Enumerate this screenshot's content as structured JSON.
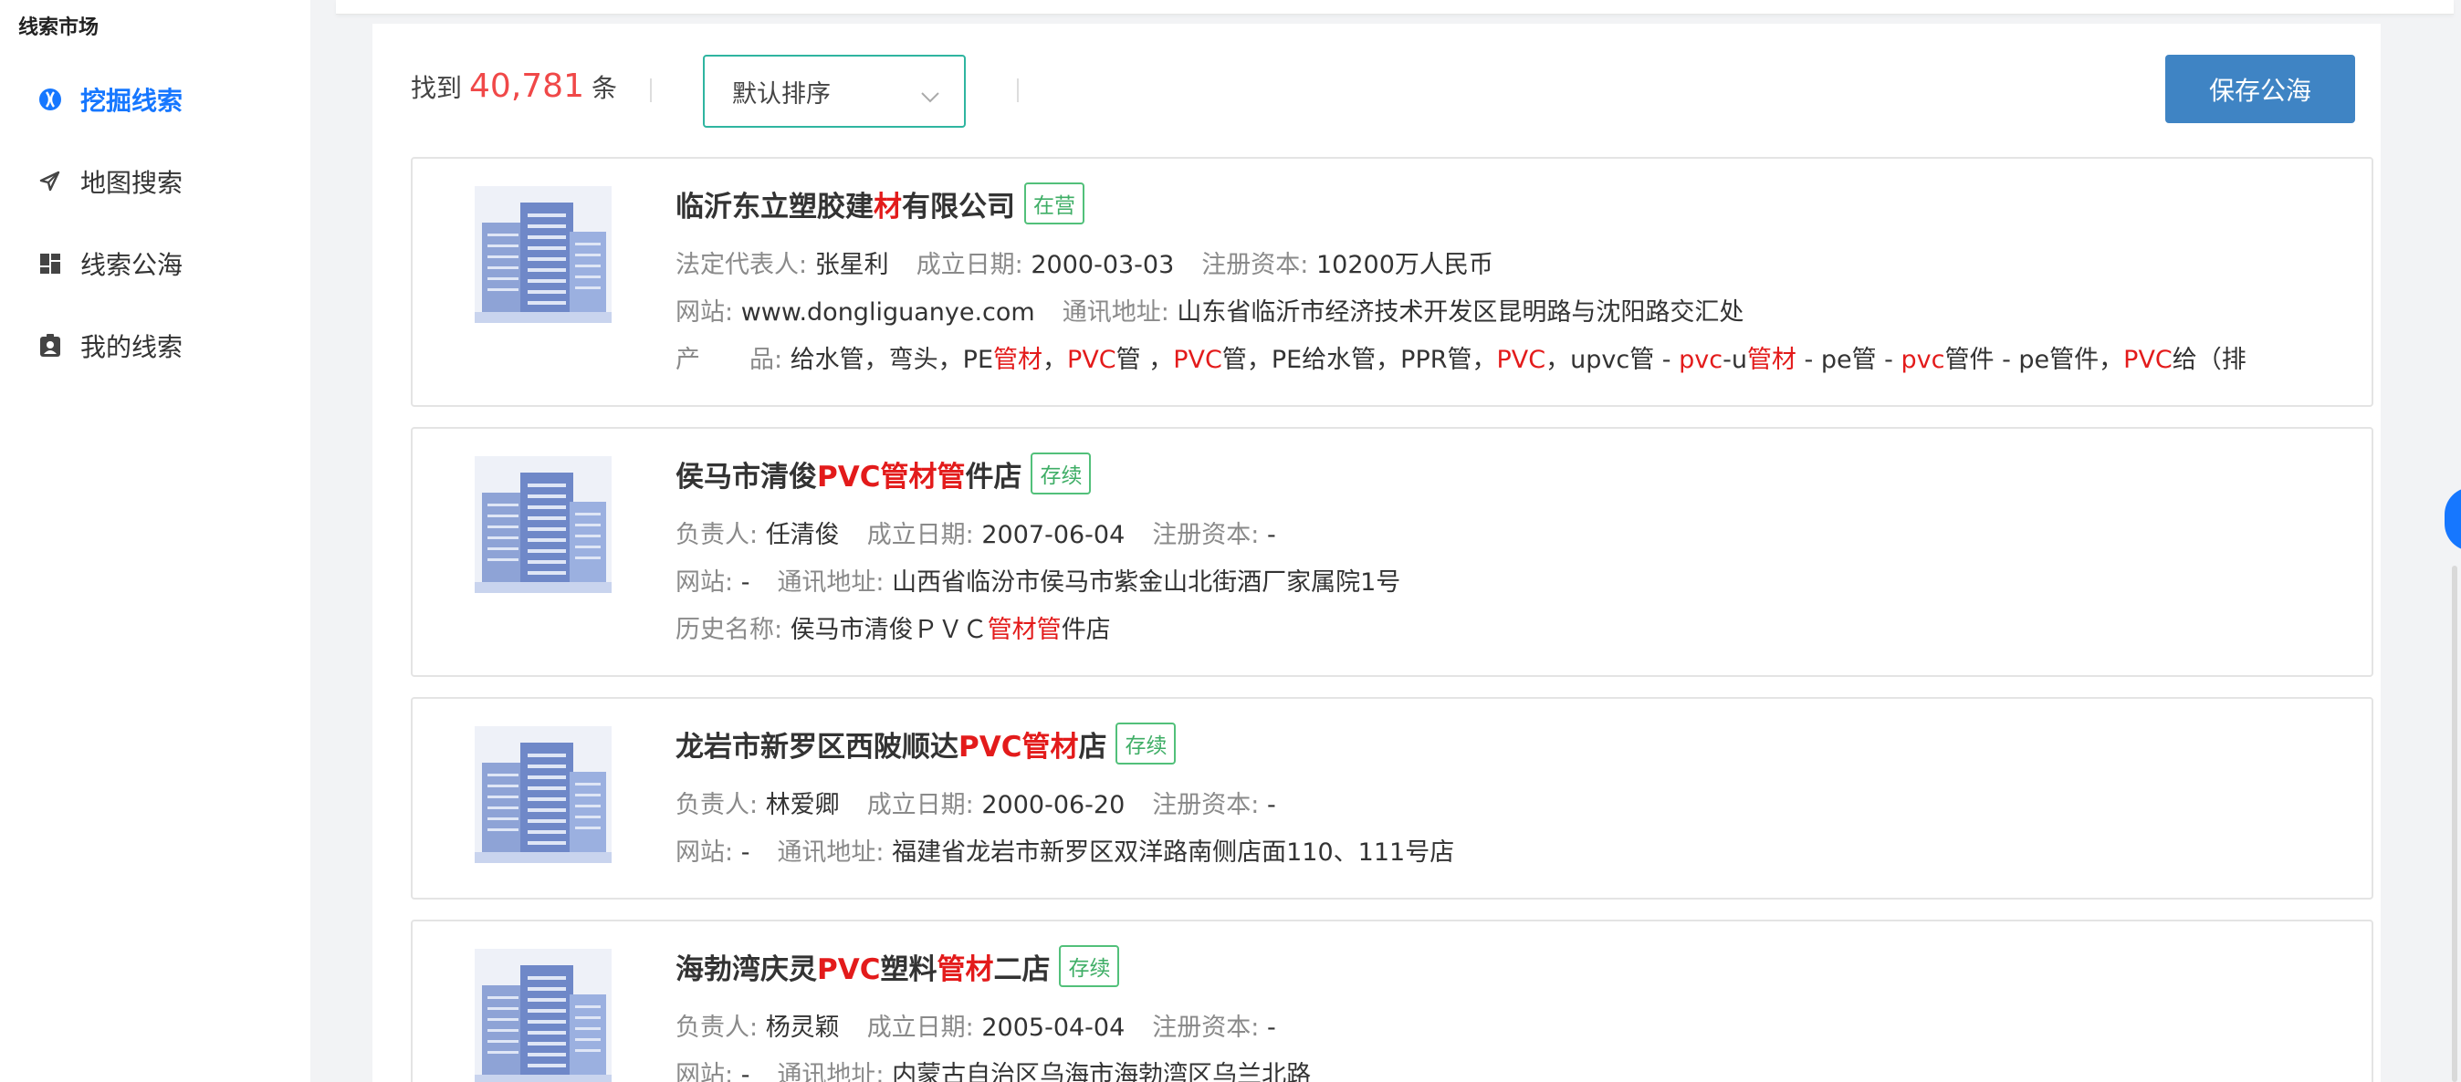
{
  "sidebar": {
    "title": "线索市场",
    "items": [
      {
        "label": "挖掘线索",
        "icon": "compass-icon",
        "active": true
      },
      {
        "label": "地图搜索",
        "icon": "send-icon",
        "active": false
      },
      {
        "label": "线索公海",
        "icon": "dashboard-icon",
        "active": false
      },
      {
        "label": "我的线索",
        "icon": "contact-card-icon",
        "active": false
      }
    ]
  },
  "toolbar": {
    "found_prefix": "找到",
    "count": "40,781",
    "found_suffix": "条",
    "sort_value": "默认排序",
    "save_label": "保存公海"
  },
  "results": [
    {
      "name_parts": [
        {
          "text": "临沂东立塑胶建",
          "hl": false
        },
        {
          "text": "材",
          "hl": true
        },
        {
          "text": "有限公司",
          "hl": false
        }
      ],
      "status": "在营",
      "rows": [
        [
          {
            "label": "法定代表人: ",
            "value": "张星利"
          },
          {
            "label": "成立日期: ",
            "value": "2000-03-03"
          },
          {
            "label": "注册资本: ",
            "value": "10200万人民币"
          }
        ],
        [
          {
            "label": "网站: ",
            "value": "www.dongliguanye.com"
          },
          {
            "label": "通讯地址: ",
            "value": "山东省临沂市经济技术开发区昆明路与沈阳路交汇处"
          }
        ]
      ],
      "extra": {
        "label": "产　　品: ",
        "parts": [
          {
            "text": "给水管，弯头，PE",
            "hl": false
          },
          {
            "text": "管材",
            "hl": true
          },
          {
            "text": "，",
            "hl": false
          },
          {
            "text": "PVC",
            "hl": true
          },
          {
            "text": "管 ，",
            "hl": false
          },
          {
            "text": "PVC",
            "hl": true
          },
          {
            "text": "管，PE给水管，PPR管，",
            "hl": false
          },
          {
            "text": "PVC",
            "hl": true
          },
          {
            "text": "，upvc管 - ",
            "hl": false
          },
          {
            "text": "pvc",
            "hl": true
          },
          {
            "text": "-u",
            "hl": false
          },
          {
            "text": "管材",
            "hl": true
          },
          {
            "text": " - pe管 - ",
            "hl": false
          },
          {
            "text": "pvc",
            "hl": true
          },
          {
            "text": "管件 - pe管件，",
            "hl": false
          },
          {
            "text": "PVC",
            "hl": true
          },
          {
            "text": "给（排",
            "hl": false
          }
        ]
      }
    },
    {
      "name_parts": [
        {
          "text": "侯马市清俊",
          "hl": false
        },
        {
          "text": "PVC管材管",
          "hl": true
        },
        {
          "text": "件店",
          "hl": false
        }
      ],
      "status": "存续",
      "rows": [
        [
          {
            "label": "负责人: ",
            "value": "任清俊"
          },
          {
            "label": "成立日期: ",
            "value": "2007-06-04"
          },
          {
            "label": "注册资本: ",
            "value": "-"
          }
        ],
        [
          {
            "label": "网站: ",
            "value": "-"
          },
          {
            "label": "通讯地址: ",
            "value": "山西省临汾市侯马市紫金山北街酒厂家属院1号"
          }
        ]
      ],
      "extra": {
        "label": "历史名称: ",
        "parts": [
          {
            "text": "侯马市清俊ＰＶＣ",
            "hl": false
          },
          {
            "text": "管材管",
            "hl": true
          },
          {
            "text": "件店",
            "hl": false
          }
        ]
      }
    },
    {
      "name_parts": [
        {
          "text": "龙岩市新罗区西陂顺达",
          "hl": false
        },
        {
          "text": "PVC管材",
          "hl": true
        },
        {
          "text": "店",
          "hl": false
        }
      ],
      "status": "存续",
      "rows": [
        [
          {
            "label": "负责人: ",
            "value": "林爱卿"
          },
          {
            "label": "成立日期: ",
            "value": "2000-06-20"
          },
          {
            "label": "注册资本: ",
            "value": "-"
          }
        ],
        [
          {
            "label": "网站: ",
            "value": "-"
          },
          {
            "label": "通讯地址: ",
            "value": "福建省龙岩市新罗区双洋路南侧店面110、111号店"
          }
        ]
      ]
    },
    {
      "name_parts": [
        {
          "text": "海勃湾庆灵",
          "hl": false
        },
        {
          "text": "PVC",
          "hl": true
        },
        {
          "text": "塑料",
          "hl": false
        },
        {
          "text": "管材",
          "hl": true
        },
        {
          "text": "二店",
          "hl": false
        }
      ],
      "status": "存续",
      "rows": [
        [
          {
            "label": "负责人: ",
            "value": "杨灵颖"
          },
          {
            "label": "成立日期: ",
            "value": "2005-04-04"
          },
          {
            "label": "注册资本: ",
            "value": "-"
          }
        ],
        [
          {
            "label": "网站: ",
            "value": "-"
          },
          {
            "label": "通讯地址: ",
            "value": "内蒙古自治区乌海市海勃湾区乌兰北路"
          }
        ]
      ]
    }
  ],
  "colors": {
    "accent": "#1677ff",
    "highlight": "#e31b1b",
    "count": "#f04848",
    "badge": "#52c07a",
    "save_button": "#3f84c4"
  }
}
